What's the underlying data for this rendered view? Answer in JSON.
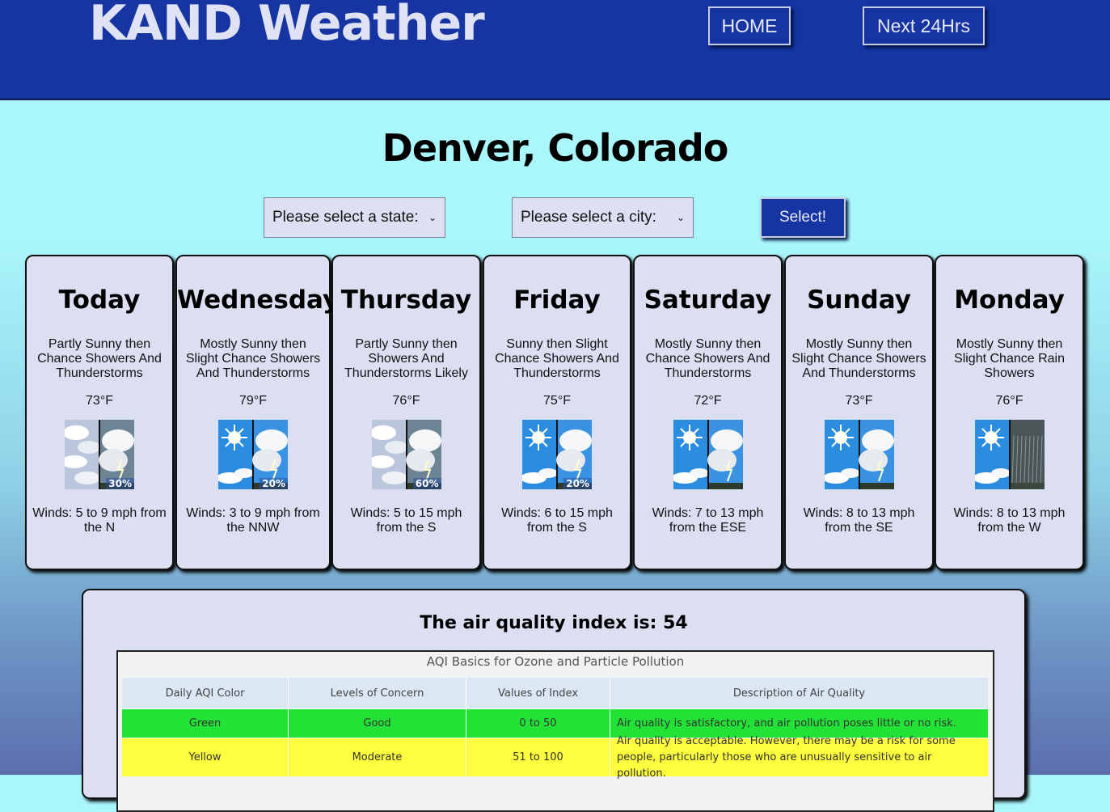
{
  "header": {
    "logo": "KAND Weather",
    "nav": {
      "home": "HOME",
      "next24": "Next 24Hrs"
    },
    "bg_color": "#1635a3"
  },
  "location": {
    "title": "Denver, Colorado"
  },
  "controls": {
    "state_select": "Please select a state:",
    "city_select": "Please select a city:",
    "select_button": "Select!"
  },
  "forecast": [
    {
      "day": "Today",
      "desc": "Partly Sunny then Chance Showers And Thunderstorms",
      "temp": "73°F",
      "icon": "partly-sunny-tstorms-icon",
      "precip": "30%",
      "winds": "Winds: 5 to 9 mph from the N"
    },
    {
      "day": "Wednesday",
      "desc": "Mostly Sunny then Slight Chance Showers And Thunderstorms",
      "temp": "79°F",
      "icon": "mostly-sunny-tstorms-icon",
      "precip": "20%",
      "winds": "Winds: 3 to 9 mph from the NNW"
    },
    {
      "day": "Thursday",
      "desc": "Partly Sunny then Showers And Thunderstorms Likely",
      "temp": "76°F",
      "icon": "partly-sunny-tstorms-icon",
      "precip": "60%",
      "winds": "Winds: 5 to 15 mph from the S"
    },
    {
      "day": "Friday",
      "desc": "Sunny then Slight Chance Showers And Thunderstorms",
      "temp": "75°F",
      "icon": "sunny-tstorms-icon",
      "precip": "20%",
      "winds": "Winds: 6 to 15 mph from the S"
    },
    {
      "day": "Saturday",
      "desc": "Mostly Sunny then Chance Showers And Thunderstorms",
      "temp": "72°F",
      "icon": "mostly-sunny-tstorms-icon",
      "precip": "",
      "winds": "Winds: 7 to 13 mph from the ESE"
    },
    {
      "day": "Sunday",
      "desc": "Mostly Sunny then Slight Chance Showers And Thunderstorms",
      "temp": "73°F",
      "icon": "mostly-sunny-tstorms-icon",
      "precip": "",
      "winds": "Winds: 8 to 13 mph from the SE"
    },
    {
      "day": "Monday",
      "desc": "Mostly Sunny then Slight Chance Rain Showers",
      "temp": "76°F",
      "icon": "mostly-sunny-rain-icon",
      "precip": "",
      "winds": "Winds: 8 to 13 mph from the W"
    }
  ],
  "air_quality": {
    "title": "The air quality index is: 54",
    "table": {
      "caption": "AQI Basics for Ozone and Particle Pollution",
      "headers": [
        "Daily AQI Color",
        "Levels of Concern",
        "Values of Index",
        "Description of Air Quality"
      ],
      "rows": [
        [
          "Green",
          "Good",
          "0 to 50",
          "Air quality is satisfactory, and air pollution poses little or no risk."
        ],
        [
          "Yellow",
          "Moderate",
          "51 to 100",
          "Air quality is acceptable. However, there may be a risk for some people, particularly those who are unusually sensitive to air pollution."
        ]
      ],
      "row_colors": [
        "#22e236",
        "#fefe3e"
      ]
    }
  }
}
